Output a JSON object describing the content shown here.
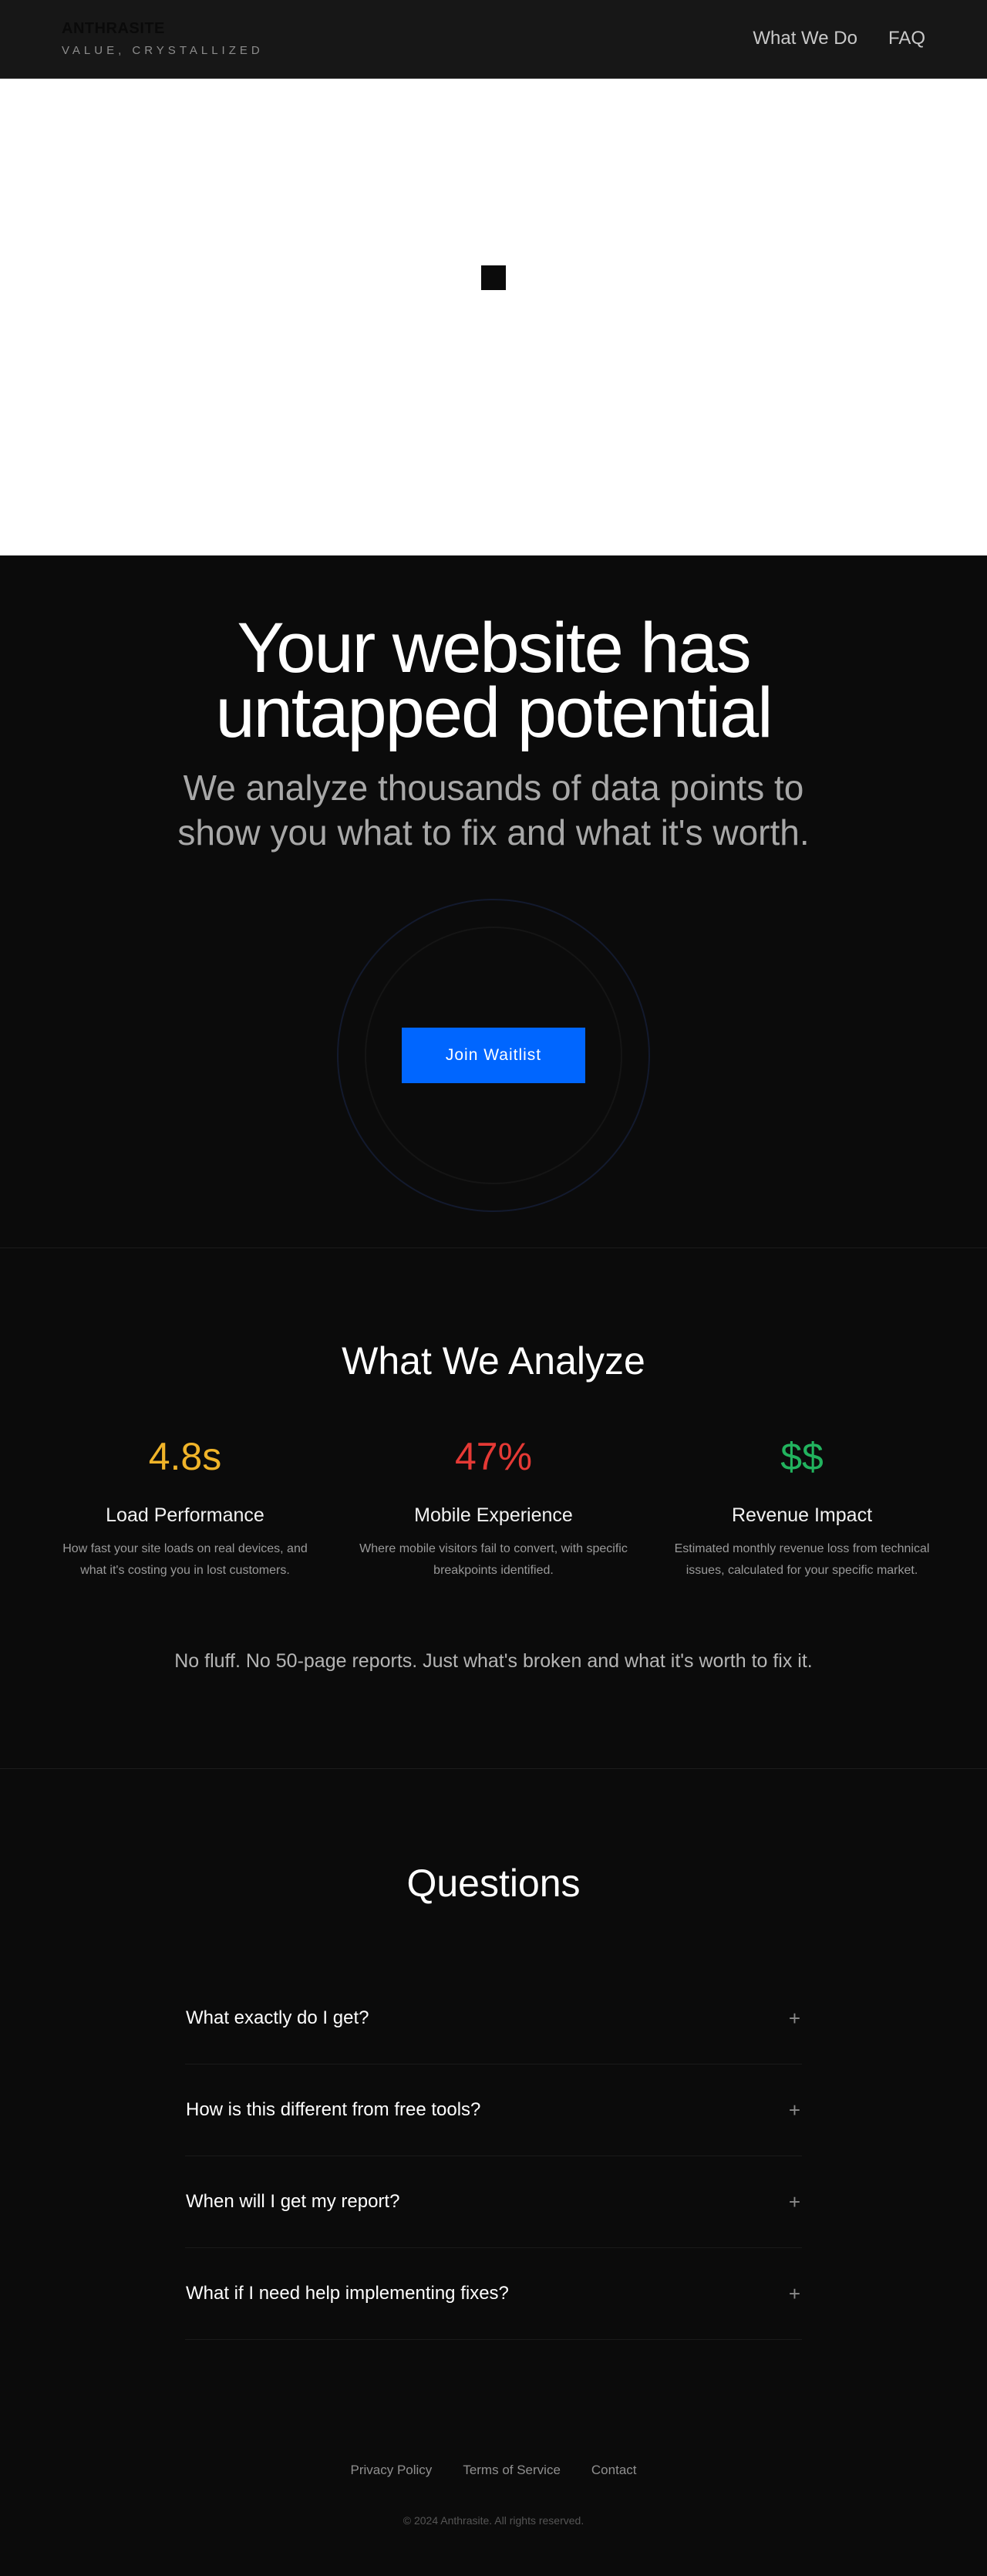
{
  "header": {
    "brand_name": "ANTHRASITE",
    "brand_tagline": "VALUE, CRYSTALLIZED",
    "nav": [
      {
        "label": "What We Do"
      },
      {
        "label": "FAQ"
      }
    ]
  },
  "hero": {
    "title_line1": "Your website has",
    "title_line2": "untapped potential",
    "subtitle": "We analyze thousands of data points to show you what to fix and what it's worth.",
    "cta_label": "Join Waitlist",
    "cta_color": "#0066ff"
  },
  "analyze": {
    "title": "What We Analyze",
    "cards": [
      {
        "metric": "4.8s",
        "metric_color": "#f0b429",
        "title": "Load Performance",
        "description": "How fast your site loads on real devices, and what it's costing you in lost customers."
      },
      {
        "metric": "47%",
        "metric_color": "#e53935",
        "title": "Mobile Experience",
        "description": "Where mobile visitors fail to convert, with specific breakpoints identified."
      },
      {
        "metric": "$$",
        "metric_color": "#22b35e",
        "title": "Revenue Impact",
        "description": "Estimated monthly revenue loss from technical issues, calculated for your specific market."
      }
    ],
    "tagline": "No fluff. No 50-page reports. Just what's broken and what it's worth to fix it."
  },
  "faq": {
    "title": "Questions",
    "items": [
      {
        "question": "What exactly do I get?",
        "icon": "plus-icon",
        "toggle": "+"
      },
      {
        "question": "How is this different from free tools?",
        "icon": "plus-icon",
        "toggle": "+"
      },
      {
        "question": "When will I get my report?",
        "icon": "plus-icon",
        "toggle": "+"
      },
      {
        "question": "What if I need help implementing fixes?",
        "icon": "plus-icon",
        "toggle": "+"
      }
    ]
  },
  "footer": {
    "links": [
      {
        "label": "Privacy Policy"
      },
      {
        "label": "Terms of Service"
      },
      {
        "label": "Contact"
      }
    ],
    "copyright": "© 2024 Anthrasite. All rights reserved."
  }
}
